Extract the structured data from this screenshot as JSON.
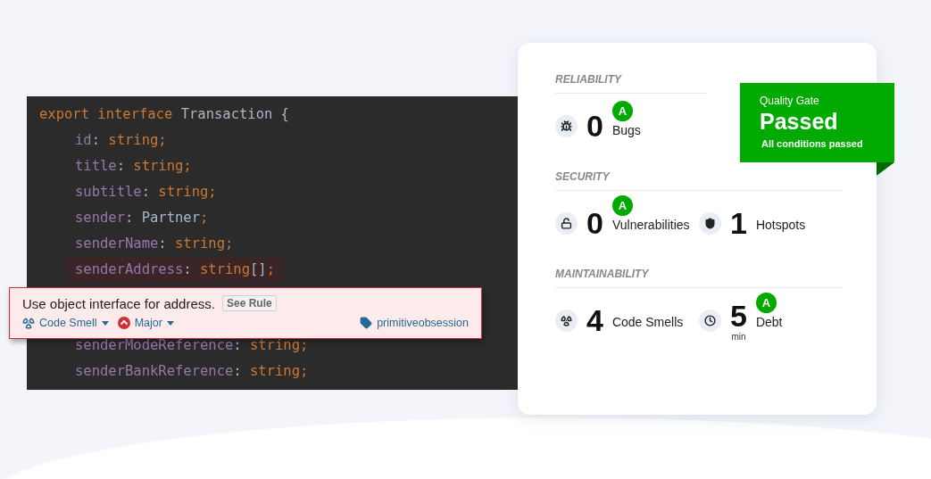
{
  "code": {
    "declaration": [
      {
        "kind": "keyword",
        "text": "export interface "
      },
      {
        "kind": "plain",
        "text": "Transaction {"
      }
    ],
    "members": [
      {
        "highlighted": false,
        "tokens": [
          {
            "kind": "property",
            "text": "id"
          },
          {
            "kind": "plain",
            "text": ": "
          },
          {
            "kind": "type",
            "text": "string;"
          }
        ]
      },
      {
        "highlighted": false,
        "tokens": [
          {
            "kind": "property",
            "text": "title"
          },
          {
            "kind": "plain",
            "text": ": "
          },
          {
            "kind": "type",
            "text": "string;"
          }
        ]
      },
      {
        "highlighted": false,
        "tokens": [
          {
            "kind": "property",
            "text": "subtitle"
          },
          {
            "kind": "plain",
            "text": ": "
          },
          {
            "kind": "type",
            "text": "string;"
          }
        ]
      },
      {
        "highlighted": false,
        "tokens": [
          {
            "kind": "property",
            "text": "sender"
          },
          {
            "kind": "plain",
            "text": ": Partner"
          },
          {
            "kind": "type",
            "text": ";"
          }
        ]
      },
      {
        "highlighted": false,
        "tokens": [
          {
            "kind": "property",
            "text": "senderName"
          },
          {
            "kind": "plain",
            "text": ": "
          },
          {
            "kind": "type",
            "text": "string;"
          }
        ]
      },
      {
        "highlighted": true,
        "tokens": [
          {
            "kind": "property",
            "text": "senderAddress"
          },
          {
            "kind": "plain",
            "text": ": "
          },
          {
            "kind": "type",
            "text": "string"
          },
          {
            "kind": "plain",
            "text": "[]"
          },
          {
            "kind": "type",
            "text": ";"
          }
        ]
      },
      {
        "highlighted": false,
        "tokens": [
          {
            "kind": "property",
            "text": "senderModeReference"
          },
          {
            "kind": "plain",
            "text": ": "
          },
          {
            "kind": "type",
            "text": "string;"
          }
        ]
      },
      {
        "highlighted": false,
        "tokens": [
          {
            "kind": "property",
            "text": "senderBankReference"
          },
          {
            "kind": "plain",
            "text": ": "
          },
          {
            "kind": "type",
            "text": "string;"
          }
        ]
      }
    ]
  },
  "issue": {
    "message": "Use object interface for address.",
    "rule_button": "See Rule",
    "type": "Code Smell",
    "severity": "Major",
    "tag": "primitiveobsession"
  },
  "quality_gate": {
    "title": "Quality Gate",
    "status": "Passed",
    "detail": "All conditions passed"
  },
  "sections": [
    {
      "title": "RELIABILITY",
      "metrics": [
        {
          "kind": "bug",
          "value": "0",
          "label": "Bugs",
          "rating": "A"
        }
      ]
    },
    {
      "title": "SECURITY",
      "metrics": [
        {
          "kind": "vulnerability",
          "value": "0",
          "label": "Vulnerabilities",
          "rating": "A"
        },
        {
          "kind": "hotspot",
          "value": "1",
          "label": "Hotspots"
        }
      ]
    },
    {
      "title": "MAINTAINABILITY",
      "metrics": [
        {
          "kind": "code-smell",
          "value": "4",
          "label": "Code Smells"
        },
        {
          "kind": "debt",
          "value": "5",
          "unit": "min",
          "label": "Debt",
          "rating": "A"
        }
      ]
    }
  ]
}
